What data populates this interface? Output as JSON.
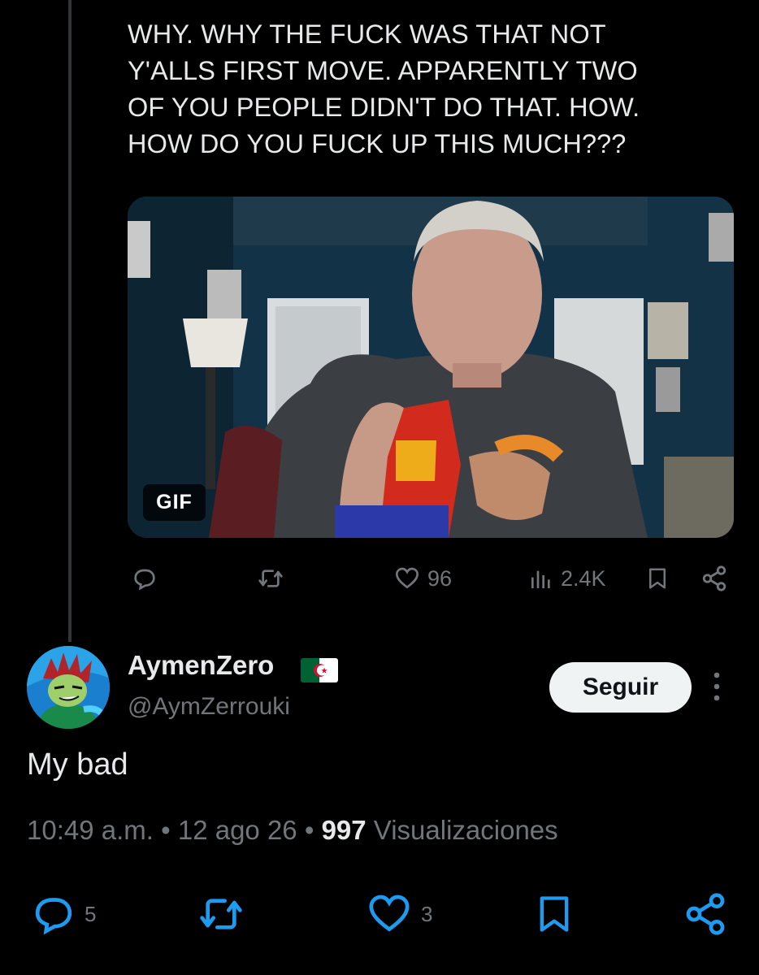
{
  "quoted_post": {
    "text": "WHY. WHY THE FUCK WAS THAT NOT\nY'ALLS FIRST MOVE. APPARENTLY TWO\nOF YOU PEOPLE DIDN'T DO THAT. HOW.\nHOW DO YOU FUCK UP THIS MUCH???",
    "media_badge": "GIF",
    "actions": {
      "reply_count": "",
      "retweet_count": "",
      "like_count": "96",
      "view_count": "2.4K"
    }
  },
  "reply_post": {
    "display_name": "AymenZero",
    "handle": "@AymZerrouki",
    "follow_label": "Seguir",
    "text": "My bad",
    "time": "10:49 a.m.",
    "separator": "•",
    "date": "12 ago 26",
    "views_count": "997",
    "views_label": "Visualizaciones",
    "actions": {
      "reply_count": "5",
      "retweet_count": "",
      "like_count": "3"
    }
  },
  "icons": {
    "reply": "reply-icon",
    "retweet": "retweet-icon",
    "like": "heart-icon",
    "views": "views-chart-icon",
    "bookmark": "bookmark-icon",
    "share": "share-icon",
    "more": "more-vertical-icon",
    "flag": "algeria-flag-icon"
  },
  "colors": {
    "background": "#000000",
    "text": "#e7e9ea",
    "muted": "#71767b",
    "thread_line": "#333639",
    "button_bg": "#eff3f4"
  }
}
